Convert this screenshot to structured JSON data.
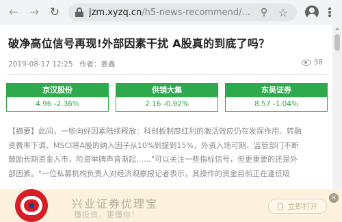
{
  "browser": {
    "url_host": "jzm.xyzq.cn",
    "url_path": "/h5-news-recommend/..."
  },
  "article": {
    "title": "破净高位信号再现!外部因素干扰 A股真的到底了吗？",
    "date": "2019-08-17 12:25",
    "author": "作者：姜鑫",
    "views": "38"
  },
  "stocks": [
    {
      "name": "京汉股份",
      "value": "4.96 -2.36%"
    },
    {
      "name": "供销大集",
      "value": "2.16 -0.92%"
    },
    {
      "name": "东吴证券",
      "value": "8.57 -1.04%"
    }
  ],
  "abstract_lines": [
    "【摘要】此间，一些向好因素陆续释放：科创板制度红利的激活效应仍在发挥作用、转融",
    "资费率下调、MSCI将A股的纳入因子从10%到提到15%，外资入场可期、监管部门不断",
    "鼓励长期资金入市，险资举牌声音渐起……\"可以关注一些指标信号，但更重要的还是外",
    "部因素。\"一位私募机构负责人对经济观察报记者表示，其操作的资金目前正在逢低吸"
  ],
  "ad": {
    "title": "兴业证券优理宝",
    "subtitle": "懂投资，更懂你！",
    "button": "立即打开",
    "close": "×"
  },
  "colors": {
    "stock_green": "#2eaa4c",
    "ad_bg": "#fbf1dc",
    "logo_red": "#d41f26"
  },
  "icons": [
    "back-arrow-icon",
    "forward-arrow-icon",
    "reload-icon",
    "lock-icon",
    "zoom-icon",
    "star-icon",
    "profile-icon",
    "menu-icon",
    "eye-icon",
    "phone-icon",
    "close-icon"
  ]
}
